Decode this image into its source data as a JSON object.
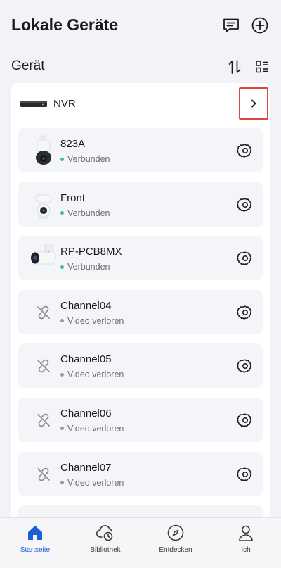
{
  "header": {
    "title": "Lokale Geräte",
    "icons": [
      "chat-icon",
      "plus-circle-icon"
    ]
  },
  "section": {
    "title": "Gerät",
    "icons": [
      "sort-icon",
      "grid-view-icon"
    ]
  },
  "nvr": {
    "label": "NVR"
  },
  "cameras": [
    {
      "name": "823A",
      "status": "Verbunden",
      "state": "online"
    },
    {
      "name": "Front",
      "status": "Verbunden",
      "state": "online"
    },
    {
      "name": "RP-PCB8MX",
      "status": "Verbunden",
      "state": "online"
    },
    {
      "name": "Channel04",
      "status": "Video verloren",
      "state": "lost"
    },
    {
      "name": "Channel05",
      "status": "Video verloren",
      "state": "lost"
    },
    {
      "name": "Channel06",
      "status": "Video verloren",
      "state": "lost"
    },
    {
      "name": "Channel07",
      "status": "Video verloren",
      "state": "lost"
    }
  ],
  "tabs": [
    {
      "label": "Startseite",
      "icon": "home-icon",
      "active": true
    },
    {
      "label": "Bibliothek",
      "icon": "cloud-clock-icon",
      "active": false
    },
    {
      "label": "Entdecken",
      "icon": "compass-icon",
      "active": false
    },
    {
      "label": "Ich",
      "icon": "person-icon",
      "active": false
    }
  ],
  "colors": {
    "accent": "#1f5fd6",
    "online": "#3fbf7f",
    "lost": "#9a9aa0",
    "highlight": "#e0463f"
  }
}
